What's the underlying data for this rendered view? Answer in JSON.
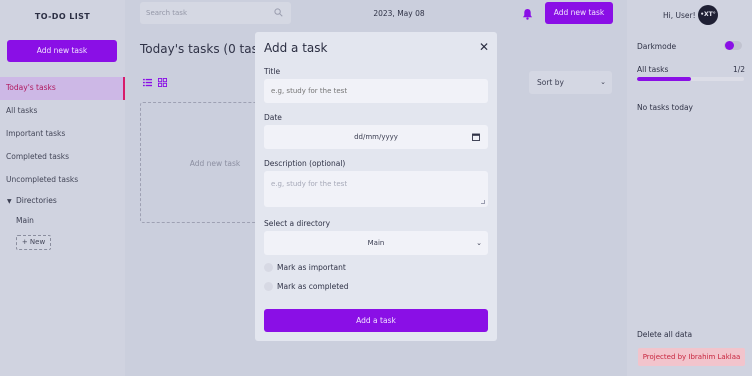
{
  "app": {
    "title": "TO-DO LIST"
  },
  "sidebar": {
    "add_label": "Add new task",
    "items": [
      {
        "label": "Today's tasks",
        "active": true
      },
      {
        "label": "All tasks"
      },
      {
        "label": "Important tasks"
      },
      {
        "label": "Completed tasks"
      },
      {
        "label": "Uncompleted tasks"
      }
    ],
    "directories_label": "Directories",
    "directories": [
      "Main"
    ],
    "new_dir_label": "+ New"
  },
  "header": {
    "search_placeholder": "Search task",
    "date": "2023, May 08",
    "add_label": "Add new task"
  },
  "main": {
    "title": "Today's tasks (0 tasks)",
    "add_card_label": "Add new task",
    "sort_label": "Sort by"
  },
  "right": {
    "greeting": "Hi, User!",
    "avatar_text": "•XT°",
    "darkmode_label": "Darkmode",
    "all_tasks_label": "All tasks",
    "all_tasks_count": "1/2",
    "all_tasks_progress": 0.5,
    "no_tasks": "No tasks today",
    "delete_all": "Delete all data",
    "credit": "Projected by Ibrahim Laklaa"
  },
  "modal": {
    "title": "Add a task",
    "close": "✕",
    "title_label": "Title",
    "title_placeholder": "e.g, study for the test",
    "date_label": "Date",
    "date_value": "dd/mm/yyyy",
    "desc_label": "Description (optional)",
    "desc_placeholder": "e.g, study for the test",
    "dir_label": "Select a directory",
    "dir_value": "Main",
    "important_label": "Mark as important",
    "completed_label": "Mark as completed",
    "submit_label": "Add a task"
  },
  "colors": {
    "accent": "#8a0fe6",
    "active_nav": "#d81b6a",
    "credit_bg": "#f2c4cc"
  }
}
